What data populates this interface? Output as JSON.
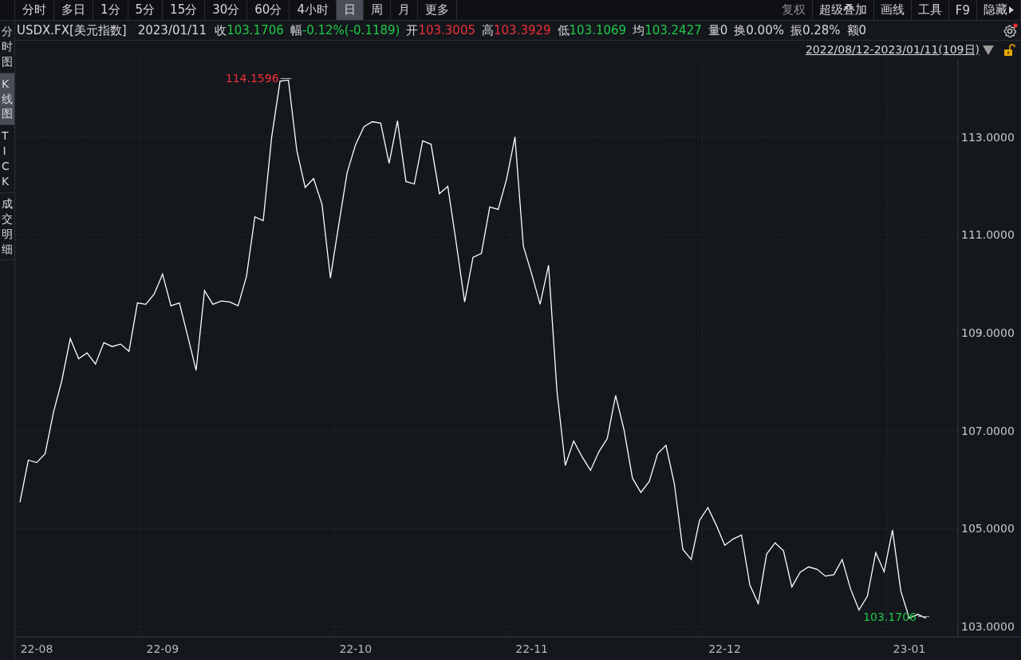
{
  "period_tabs": [
    {
      "label": "分时",
      "selected": false
    },
    {
      "label": "多日",
      "selected": false
    },
    {
      "label": "1分",
      "selected": false
    },
    {
      "label": "5分",
      "selected": false
    },
    {
      "label": "15分",
      "selected": false
    },
    {
      "label": "30分",
      "selected": false
    },
    {
      "label": "60分",
      "selected": false
    },
    {
      "label": "4小时",
      "selected": false
    },
    {
      "label": "日",
      "selected": true
    },
    {
      "label": "周",
      "selected": false
    },
    {
      "label": "月",
      "selected": false
    },
    {
      "label": "更多",
      "selected": false
    }
  ],
  "tools": [
    {
      "label": "复权",
      "disabled": true
    },
    {
      "label": "超级叠加",
      "disabled": false
    },
    {
      "label": "画线",
      "disabled": false
    },
    {
      "label": "工具",
      "disabled": false
    },
    {
      "label": "F9",
      "disabled": false
    },
    {
      "label": "隐藏",
      "disabled": false
    }
  ],
  "quote": {
    "symbol": "USDX.FX[美元指数]",
    "date": "2023/01/11",
    "fields": [
      {
        "label": "收",
        "value": "103.1706",
        "color": "#1fc84a"
      },
      {
        "label": "幅",
        "value": "-0.12%(-0.1189)",
        "color": "#1fc84a"
      },
      {
        "label": "开",
        "value": "103.3005",
        "color": "#f0303a"
      },
      {
        "label": "高",
        "value": "103.3929",
        "color": "#f0303a"
      },
      {
        "label": "低",
        "value": "103.1069",
        "color": "#1fc84a"
      },
      {
        "label": "均",
        "value": "103.2427",
        "color": "#1fc84a"
      },
      {
        "label": "量",
        "value": "0",
        "color": "#d8d8d8"
      },
      {
        "label": "换",
        "value": "0.00%",
        "color": "#d8d8d8"
      },
      {
        "label": "振",
        "value": "0.28%",
        "color": "#d8d8d8"
      },
      {
        "label": "额",
        "value": "0",
        "color": "#d8d8d8"
      }
    ]
  },
  "date_range": "2022/08/12-2023/01/11(109日)",
  "side_tabs": [
    {
      "label": "分时图",
      "selected": false
    },
    {
      "label": "K线图",
      "selected": true
    },
    {
      "label": "TICK",
      "selected": false
    },
    {
      "label": "成交明细",
      "selected": false
    }
  ],
  "chart_data": {
    "type": "line",
    "grid": true,
    "ylim": [
      102.79,
      114.59
    ],
    "categories": [
      null,
      null,
      "22-08",
      null,
      null,
      null,
      null,
      null,
      null,
      null,
      null,
      null,
      null,
      null,
      null,
      null,
      null,
      "22-09",
      null,
      null,
      null,
      null,
      null,
      null,
      null,
      null,
      null,
      null,
      null,
      null,
      null,
      null,
      null,
      null,
      null,
      null,
      null,
      null,
      null,
      null,
      "22-10",
      null,
      null,
      null,
      null,
      null,
      null,
      null,
      null,
      null,
      null,
      null,
      null,
      null,
      null,
      null,
      null,
      null,
      null,
      null,
      null,
      "22-11",
      null,
      null,
      null,
      null,
      null,
      null,
      null,
      null,
      null,
      null,
      null,
      null,
      null,
      null,
      null,
      null,
      null,
      null,
      null,
      null,
      null,
      null,
      "22-12",
      null,
      null,
      null,
      null,
      null,
      null,
      null,
      null,
      null,
      null,
      null,
      null,
      null,
      null,
      null,
      null,
      null,
      null,
      null,
      null,
      null,
      "23-01",
      null,
      null
    ],
    "yticks": [
      {
        "value": 103,
        "label": "103.0000"
      },
      {
        "value": 105,
        "label": "105.0000"
      },
      {
        "value": 107,
        "label": "107.0000"
      },
      {
        "value": 109,
        "label": "109.0000"
      },
      {
        "value": 111,
        "label": "111.0000"
      },
      {
        "value": 113,
        "label": "113.0000"
      }
    ],
    "series": [
      {
        "color": "#ffffff",
        "values": [
          105.54,
          106.4,
          106.35,
          106.53,
          107.38,
          108.03,
          108.88,
          108.47,
          108.59,
          108.36,
          108.8,
          108.72,
          108.77,
          108.62,
          109.61,
          109.58,
          109.79,
          110.2,
          109.55,
          109.61,
          108.93,
          108.23,
          109.86,
          109.58,
          109.65,
          109.63,
          109.55,
          110.15,
          111.37,
          111.29,
          113.0,
          114.14,
          114.16,
          112.72,
          111.97,
          112.15,
          111.62,
          110.12,
          111.21,
          112.27,
          112.84,
          113.21,
          113.31,
          113.28,
          112.46,
          113.33,
          112.09,
          112.04,
          112.92,
          112.85,
          111.84,
          111.99,
          110.83,
          109.63,
          110.54,
          110.62,
          111.57,
          111.52,
          112.14,
          113.0,
          110.77,
          110.2,
          109.58,
          110.38,
          107.82,
          106.29,
          106.79,
          106.47,
          106.19,
          106.57,
          106.84,
          107.72,
          107.02,
          106.03,
          105.74,
          105.96,
          106.53,
          106.7,
          105.92,
          104.58,
          104.37,
          105.17,
          105.43,
          105.07,
          104.66,
          104.79,
          104.87,
          103.85,
          103.47,
          104.48,
          104.71,
          104.55,
          103.81,
          104.11,
          104.22,
          104.17,
          104.03,
          104.06,
          104.37,
          103.77,
          103.34,
          103.62,
          104.51,
          104.12,
          104.97,
          103.72,
          103.17,
          103.25,
          103.17
        ]
      }
    ],
    "annotations": [
      "114.1596",
      "103.1706"
    ]
  }
}
